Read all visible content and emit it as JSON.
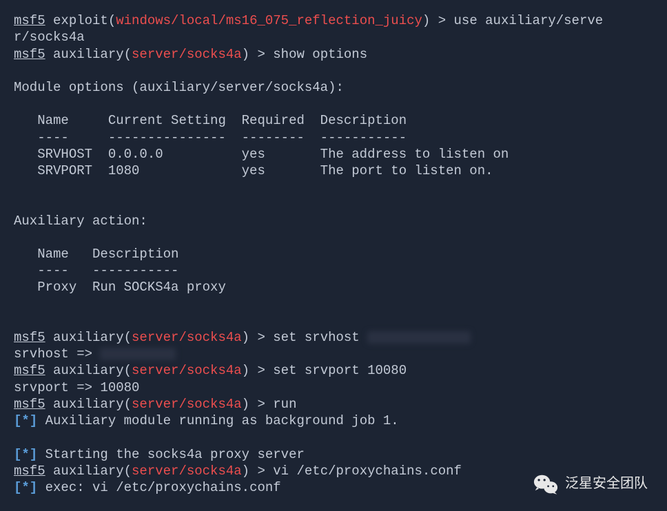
{
  "lines": {
    "l1_prompt": "msf5",
    "l1_text_a": " exploit(",
    "l1_module": "windows/local/ms16_075_reflection_juicy",
    "l1_text_b": ") > use auxiliary/serve",
    "l2": "r/socks4a",
    "l3_prompt": "msf5",
    "l3_text_a": " auxiliary(",
    "l3_module": "server/socks4a",
    "l3_text_b": ") > show options",
    "l5": "Module options (auxiliary/server/socks4a):",
    "l7": "   Name     Current Setting  Required  Description",
    "l8": "   ----     ---------------  --------  -----------",
    "l9": "   SRVHOST  0.0.0.0          yes       The address to listen on",
    "l10": "   SRVPORT  1080             yes       The port to listen on.",
    "l12": "Auxiliary action:",
    "l14": "   Name   Description",
    "l15": "   ----   -----------",
    "l16": "   Proxy  Run SOCKS4a proxy",
    "l18_prompt": "msf5",
    "l18_text_a": " auxiliary(",
    "l18_module": "server/socks4a",
    "l18_text_b": ") > set srvhost ",
    "l19": "srvhost => ",
    "l20_prompt": "msf5",
    "l20_text_a": " auxiliary(",
    "l20_module": "server/socks4a",
    "l20_text_b": ") > set srvport 10080",
    "l21": "srvport => 10080",
    "l22_prompt": "msf5",
    "l22_text_a": " auxiliary(",
    "l22_module": "server/socks4a",
    "l22_text_b": ") > run",
    "l23_brack_open": "[",
    "l23_star": "*",
    "l23_brack_close": "]",
    "l23_text": " Auxiliary module running as background job 1.",
    "l25_brack_open": "[",
    "l25_star": "*",
    "l25_brack_close": "]",
    "l25_text": " Starting the socks4a proxy server",
    "l26_prompt": "msf5",
    "l26_text_a": " auxiliary(",
    "l26_module": "server/socks4a",
    "l26_text_b": ") > vi /etc/proxychains.conf",
    "l27_brack_open": "[",
    "l27_star": "*",
    "l27_brack_close": "]",
    "l27_text": " exec: vi /etc/proxychains.conf"
  },
  "watermark": {
    "text": "泛星安全团队"
  }
}
